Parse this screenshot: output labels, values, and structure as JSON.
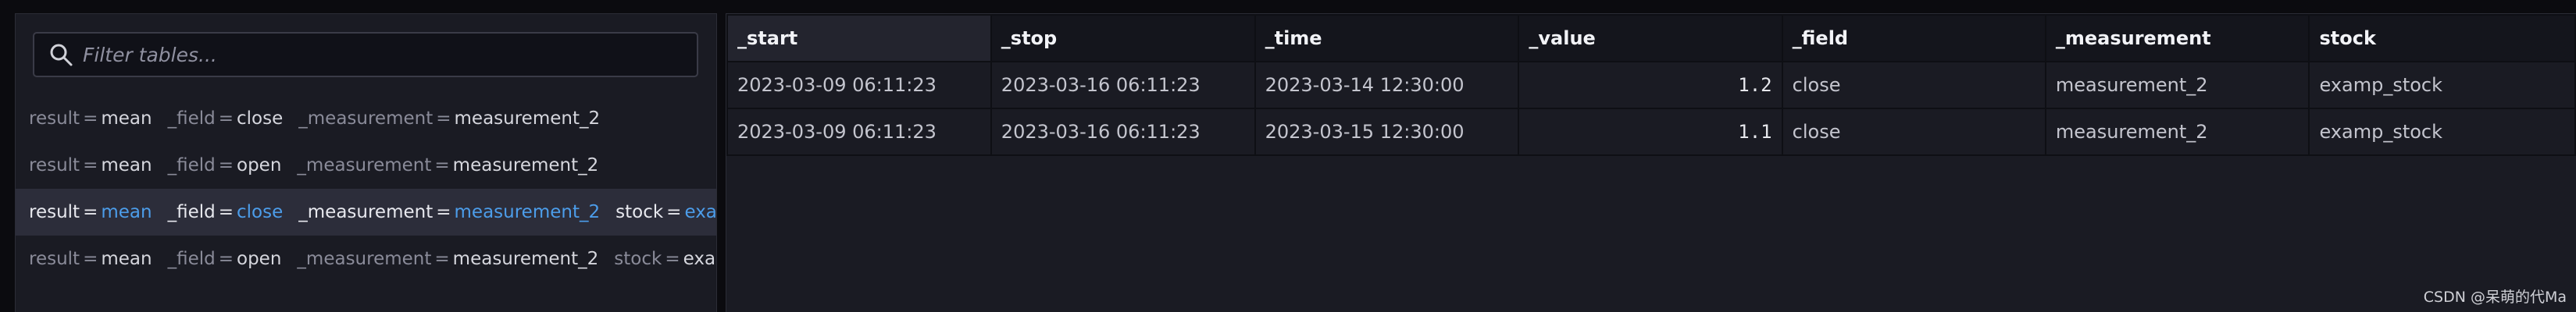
{
  "search": {
    "placeholder": "Filter tables..."
  },
  "tables": [
    {
      "result": "mean",
      "field": "close",
      "measurement": "measurement_2",
      "stock": null,
      "selected": false
    },
    {
      "result": "mean",
      "field": "open",
      "measurement": "measurement_2",
      "stock": null,
      "selected": false
    },
    {
      "result": "mean",
      "field": "close",
      "measurement": "measurement_2",
      "stock": "exam",
      "selected": true
    },
    {
      "result": "mean",
      "field": "open",
      "measurement": "measurement_2",
      "stock": "exam",
      "selected": false
    }
  ],
  "keys": {
    "result": "result",
    "field": "_field",
    "measurement": "_measurement",
    "stock": "stock",
    "eq": "="
  },
  "grid": {
    "columns": [
      "_start",
      "_stop",
      "_time",
      "_value",
      "_field",
      "_measurement",
      "stock"
    ],
    "rows": [
      [
        "2023-03-09 06:11:23",
        "2023-03-16 06:11:23",
        "2023-03-14 12:30:00",
        "1.2",
        "close",
        "measurement_2",
        "examp_stock"
      ],
      [
        "2023-03-09 06:11:23",
        "2023-03-16 06:11:23",
        "2023-03-15 12:30:00",
        "1.1",
        "close",
        "measurement_2",
        "examp_stock"
      ]
    ]
  },
  "watermark": "CSDN @呆萌的代Ma"
}
